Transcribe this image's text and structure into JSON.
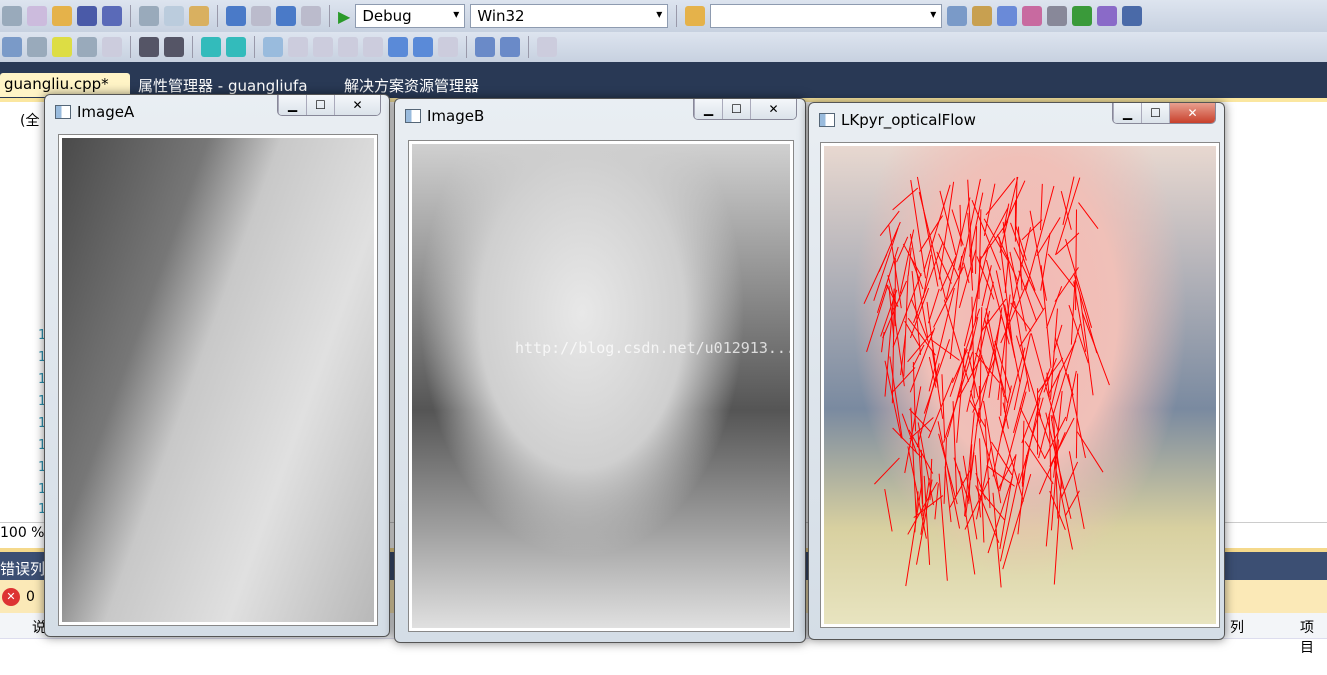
{
  "toolbar": {
    "config": "Debug",
    "platform": "Win32",
    "find_value": ""
  },
  "tabs": [
    {
      "label": "guangliu.cpp*",
      "active": true,
      "close": "✕"
    },
    {
      "label": "属性管理器 - guangliufa"
    },
    {
      "label": "解决方案资源管理器"
    }
  ],
  "editor": {
    "scope_dropdown": "(全",
    "line_numbers": [
      "1",
      "1",
      "1",
      "1",
      "1",
      "1",
      "1",
      "1",
      "1"
    ]
  },
  "status": {
    "zoom": "100 %"
  },
  "error_panel": {
    "title": "错误列表",
    "error_count": "0",
    "columns": [
      "说",
      "列",
      "项目"
    ]
  },
  "windows": [
    {
      "title": "ImageA",
      "image": "grayscale hand over laptop"
    },
    {
      "title": "ImageB",
      "image": "grayscale hand over laptop"
    },
    {
      "title": "LKpyr_opticalFlow",
      "image": "color hand with red optical flow vectors"
    }
  ],
  "watermark": "http://blog.csdn.net/u012913...",
  "colors": {
    "flow": "#ff0000",
    "title_band": "#293955",
    "active_tab": "#fff4c6"
  }
}
